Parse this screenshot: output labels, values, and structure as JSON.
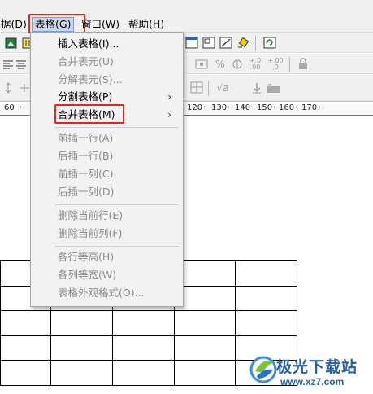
{
  "menubar": {
    "items": [
      {
        "label": "据(D)"
      },
      {
        "label": "表格(G)"
      },
      {
        "label": "窗口(W)"
      },
      {
        "label": "帮助(H)"
      }
    ]
  },
  "toolbar_icons": {
    "percent": "%",
    "sqrt": "√a",
    "decimal_up": "+.0 .00",
    "decimal_down": "+.00 .0"
  },
  "ruler": {
    "left_label": "60",
    "labels": [
      "120",
      "130",
      "140",
      "150",
      "160",
      "170"
    ]
  },
  "dropdown": {
    "groups": [
      [
        {
          "label": "插入表格(I)...",
          "enabled": true
        },
        {
          "label": "合并表元(U)",
          "enabled": false
        },
        {
          "label": "分解表元(S)...",
          "enabled": false
        },
        {
          "label": "分割表格(P)",
          "enabled": true,
          "submenu": true
        },
        {
          "label": "合并表格(M)",
          "enabled": true,
          "submenu": true
        }
      ],
      [
        {
          "label": "前插一行(A)",
          "enabled": false
        },
        {
          "label": "后插一行(B)",
          "enabled": false
        },
        {
          "label": "前插一列(C)",
          "enabled": false
        },
        {
          "label": "后插一列(D)",
          "enabled": false
        }
      ],
      [
        {
          "label": "删除当前行(E)",
          "enabled": false
        },
        {
          "label": "删除当前列(F)",
          "enabled": false
        }
      ],
      [
        {
          "label": "各行等高(H)",
          "enabled": false
        },
        {
          "label": "各列等宽(W)",
          "enabled": false
        },
        {
          "label": "表格外观格式(O)...",
          "enabled": false
        }
      ]
    ]
  },
  "watermark": {
    "brand": "极光下载站",
    "url": "www.xz7.com"
  },
  "colors": {
    "highlight_border": "#e0261f",
    "watermark_blue": "#2a5fa8",
    "menu_bg": "#f2f2f2",
    "disabled_text": "#8c8c8c"
  }
}
